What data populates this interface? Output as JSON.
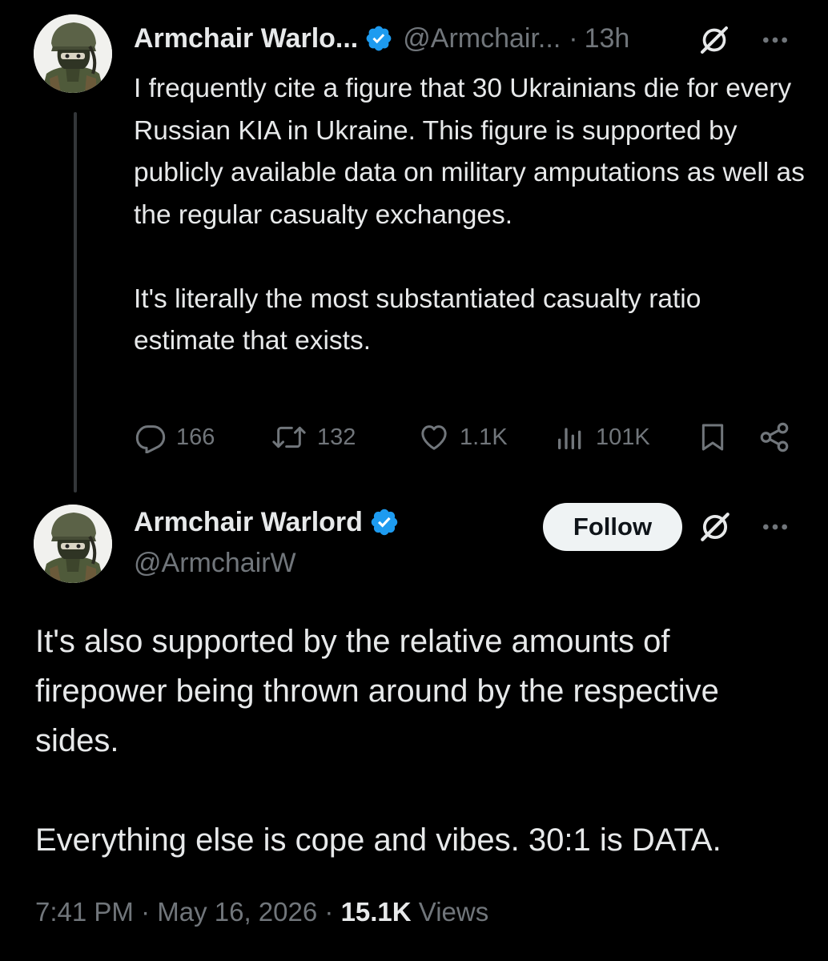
{
  "colors": {
    "background": "#000000",
    "text_primary": "#e7e9ea",
    "text_secondary": "#71767b",
    "verified_blue": "#1d9bf0",
    "thread_line": "#333639",
    "follow_button_bg": "#eff3f4"
  },
  "tweet1": {
    "author_name": "Armchair Warlo...",
    "author_handle": "@Armchair...",
    "separator": "·",
    "time": "13h",
    "icons": [
      "grok-icon",
      "more-icon",
      "verified-badge-icon"
    ],
    "text_paragraphs": [
      "I frequently cite a figure that 30 Ukrainians die for every Russian KIA in Ukraine.  This figure is supported by publicly available data on military amputations as well as the regular casualty exchanges.",
      "It's literally the most substantiated casualty ratio estimate that exists."
    ],
    "actions": {
      "replies": "166",
      "reposts": "132",
      "likes": "1.1K",
      "views": "101K",
      "icons": [
        "reply-icon",
        "repost-icon",
        "like-icon",
        "views-icon",
        "bookmark-icon",
        "share-icon"
      ]
    }
  },
  "tweet2": {
    "author_name": "Armchair Warlord",
    "author_handle": "@ArmchairW",
    "follow_label": "Follow",
    "text_paragraphs": [
      "It's also supported by the relative amounts of firepower being thrown around by the respective sides.",
      "Everything else is cope and vibes.  30:1 is DATA."
    ],
    "footer": {
      "time": "7:41 PM",
      "separator": "·",
      "date": "May 16, 2026",
      "views_count": "15.1K",
      "views_label": "Views"
    }
  }
}
